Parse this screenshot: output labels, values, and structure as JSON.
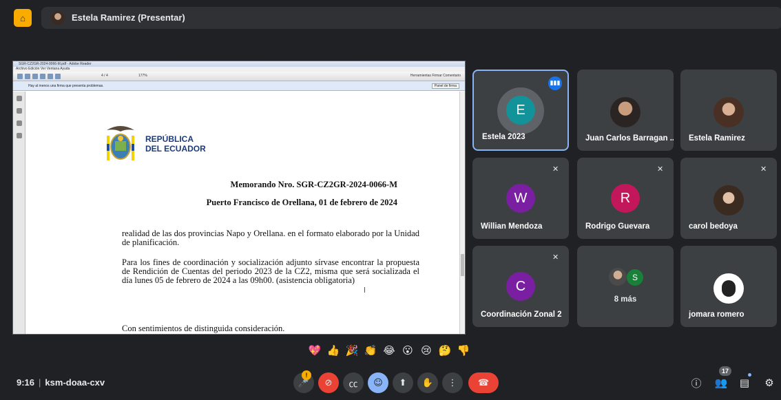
{
  "presenter": {
    "name": "Estela Ramirez (Presentar)"
  },
  "shared_screen": {
    "window_title": "SGR-CZ2GR-2024-0066-M.pdf - Adobe Reader",
    "menu": "Archivo   Edición   Ver   Ventana   Ayuda",
    "zoom": "177%",
    "page": "4 / 4",
    "toolbar_right": "Herramientas   Firmar   Comentario",
    "notice": "Hay al menos una firma que presenta problemas.",
    "panel_button": "Panel de firma",
    "document": {
      "republica": "REPÚBLICA",
      "ecuador": "DEL ECUADOR",
      "memo_number": "Memorando Nro. SGR-CZ2GR-2024-0066-M",
      "place_date": "Puerto Francisco de Orellana, 01 de febrero de 2024",
      "paragraph_1": "realidad de las dos provincias Napo y Orellana. en el formato  elaborado por la Unidad de planificación.",
      "paragraph_2": "Para los fines de coordinación y socialización adjunto sírvase encontrar la propuesta de Rendición de Cuentas del periodo 2023 de la CZ2, misma que será socializada el día lunes 05 de febrero de 2024 a las 09h00.  (asistencia obligatoria)",
      "closing": "Con sentimientos de distinguida consideración."
    }
  },
  "participants": [
    {
      "name": "Estela 2023",
      "initial": "E",
      "color": "#12939a",
      "speaking": true
    },
    {
      "name": "Juan Carlos Barragan ...",
      "photo": true
    },
    {
      "name": "Estela Ramirez",
      "photo": true
    },
    {
      "name": "Willian Mendoza",
      "initial": "W",
      "color": "#7b1fa2",
      "muted": true
    },
    {
      "name": "Rodrigo Guevara",
      "initial": "R",
      "color": "#c2185b",
      "muted": true
    },
    {
      "name": "carol bedoya",
      "photo": true,
      "muted": true
    },
    {
      "name": "Coordinación Zonal 2",
      "initial": "C",
      "color": "#7b1fa2",
      "muted": true
    },
    {
      "name": "",
      "more": "8 más",
      "mini_initial": "S"
    },
    {
      "name": "jomara romero",
      "photo": true
    }
  ],
  "reactions": [
    "💖",
    "👍",
    "🎉",
    "👏",
    "😂",
    "😮",
    "😢",
    "🤔",
    "👎"
  ],
  "meeting": {
    "time": "9:16",
    "code": "ksm-doaa-cxv"
  },
  "mic_badge": "!",
  "people_count": "17"
}
